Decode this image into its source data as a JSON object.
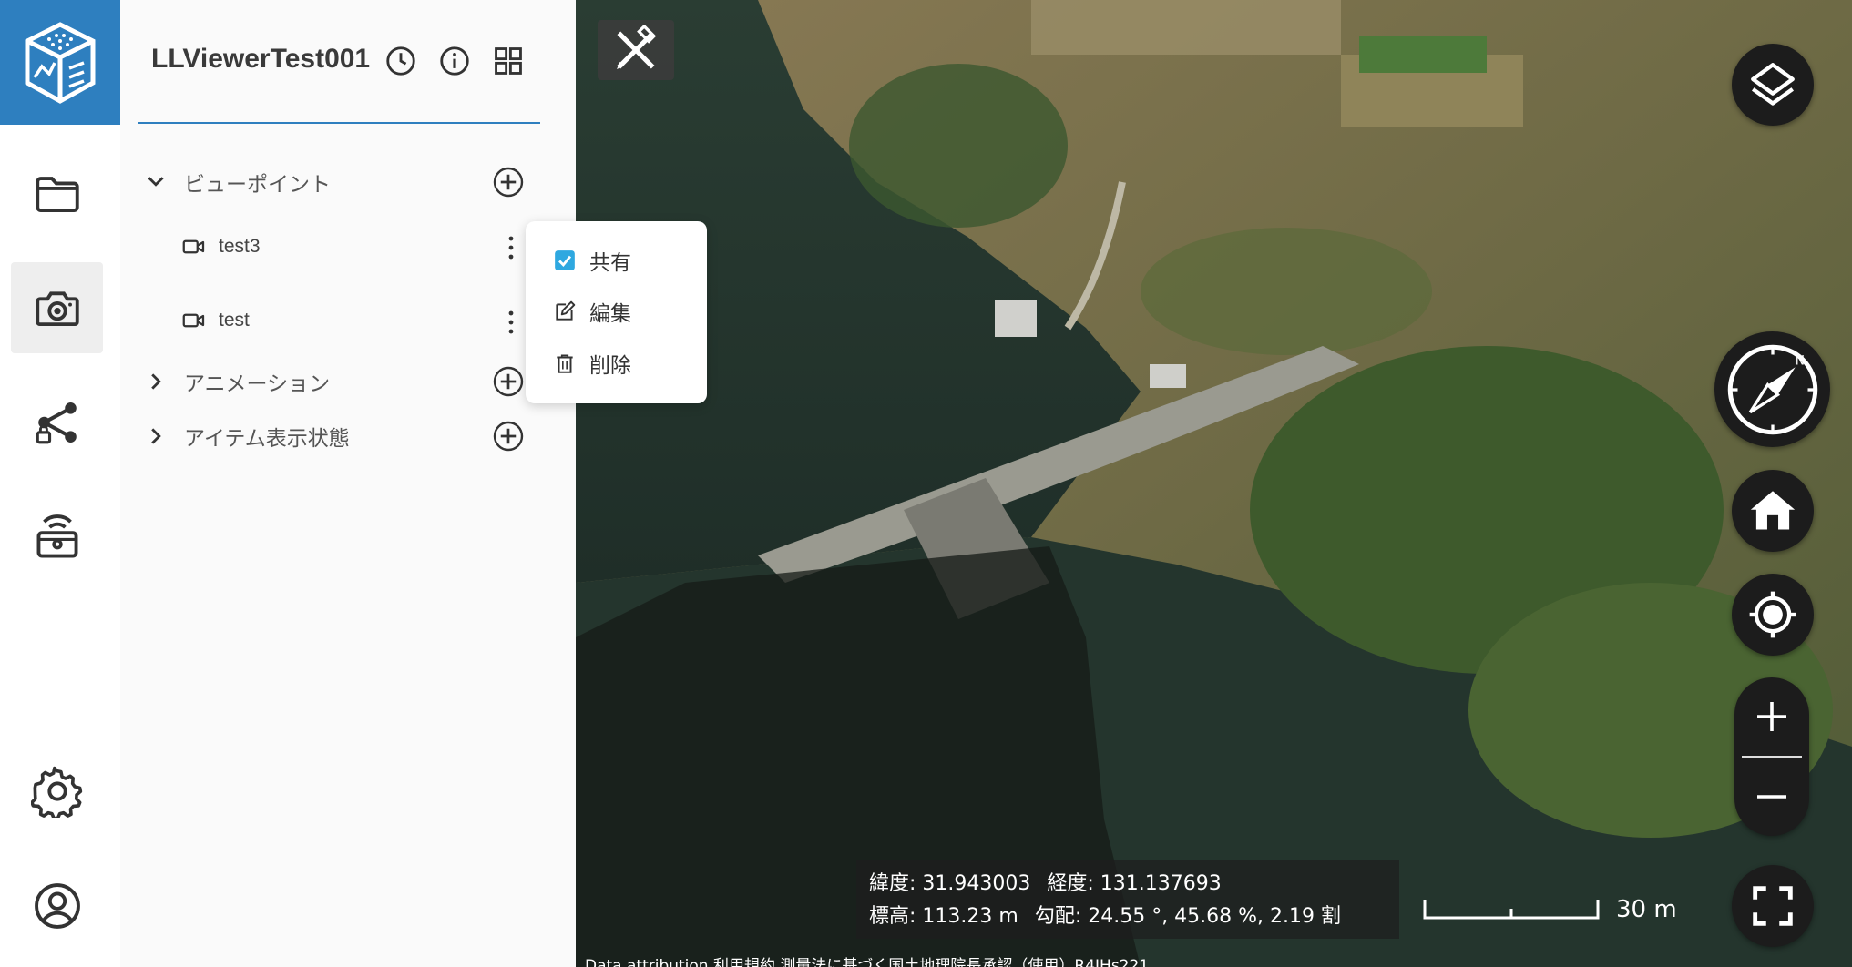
{
  "app": {
    "title": "LLViewerTest001",
    "accent_color": "#2e7fbf"
  },
  "rail": {
    "items": [
      {
        "icon": "folder-icon"
      },
      {
        "icon": "camera-icon",
        "active": true
      },
      {
        "icon": "share-lock-icon"
      },
      {
        "icon": "broadcast-icon"
      },
      {
        "icon": "gear-icon"
      },
      {
        "icon": "user-circle-icon"
      }
    ]
  },
  "header": {
    "icons": [
      "history-icon",
      "info-icon",
      "grid-icon"
    ]
  },
  "tree": {
    "viewpoints": {
      "label": "ビューポイント",
      "expanded": true,
      "items": [
        {
          "label": "test3"
        },
        {
          "label": "test"
        }
      ]
    },
    "animation": {
      "label": "アニメーション",
      "expanded": false
    },
    "item_state": {
      "label": "アイテム表示状態",
      "expanded": false
    }
  },
  "context_menu": {
    "share": {
      "label": "共有",
      "checked": true
    },
    "edit": {
      "label": "編集"
    },
    "delete": {
      "label": "削除"
    }
  },
  "map": {
    "latitude": "緯度: 31.943003",
    "longitude": "経度: 131.137693",
    "elevation": "標高: 113.23 m",
    "slope": "勾配: 24.55 °, 45.68 %, 2.19 割",
    "scale_label": "30 m",
    "attribution": "Data attribution   利用規約   測量法に基づく国土地理院長承認（使用）R4JHs221"
  }
}
